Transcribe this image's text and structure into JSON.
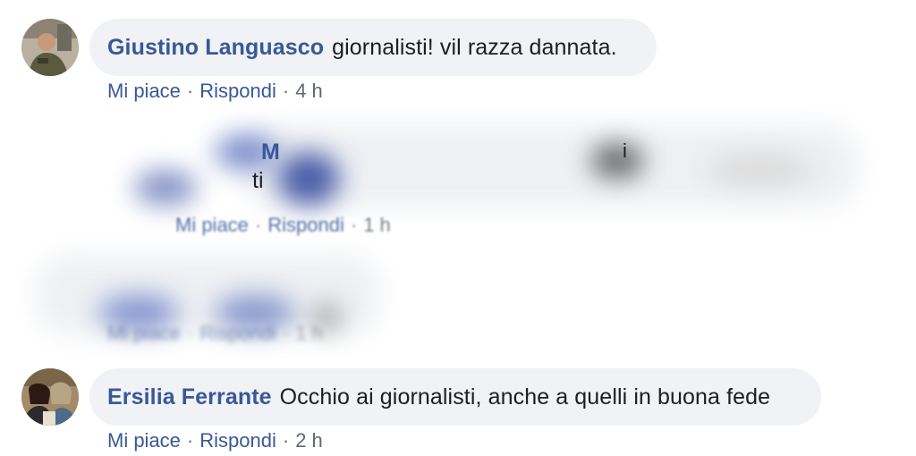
{
  "comments": [
    {
      "author": "Giustino Languasco",
      "text": "giornalisti! vil razza dannata.",
      "like": "Mi piace",
      "reply": "Rispondi",
      "time": "4 h"
    },
    {
      "author_fragment": "M",
      "text_fragment": "ti",
      "text_fragment_end": "i",
      "like": "Mi piace",
      "reply": "Rispondi",
      "time": "1 h"
    },
    {
      "like": "Mi piace",
      "reply": "Rispondi",
      "time": "1 h"
    },
    {
      "author": "Ersilia Ferrante",
      "text": "Occhio ai giornalisti, anche a quelli in buona fede",
      "like": "Mi piace",
      "reply": "Rispondi",
      "time": "2 h"
    }
  ],
  "separator": "·",
  "colors": {
    "link": "#385898",
    "bubble": "#f0f2f5",
    "muted": "#606770"
  }
}
